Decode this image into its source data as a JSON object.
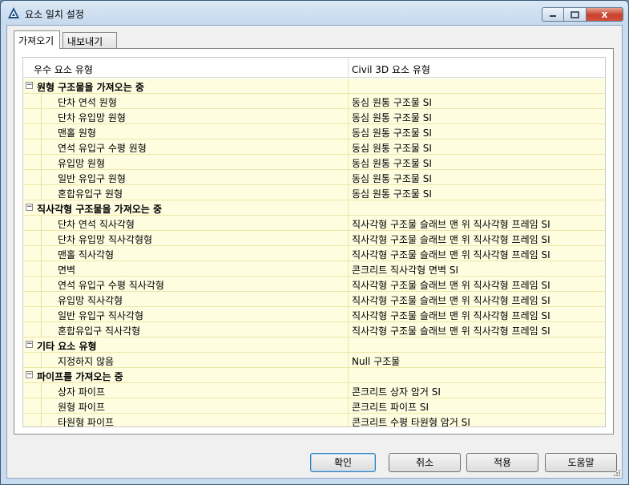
{
  "window": {
    "title": "요소 일치 설정",
    "close_label": "x"
  },
  "tabs": [
    {
      "label": "가져오기",
      "active": true
    },
    {
      "label": "내보내기",
      "active": false
    }
  ],
  "grid": {
    "columns": [
      "우수 요소 유형",
      "Civil 3D 요소 유형"
    ],
    "groups": [
      {
        "label": "원형 구조물을 가져오는 중",
        "items": [
          {
            "name": "단차 연석 원형",
            "value": "동심 원통 구조물 SI"
          },
          {
            "name": "단차 유입망 원형",
            "value": "동심 원통 구조물 SI"
          },
          {
            "name": "맨홀 원형",
            "value": "동심 원통 구조물 SI"
          },
          {
            "name": "연석 유입구 수평 원형",
            "value": "동심 원통 구조물 SI"
          },
          {
            "name": "유입망 원형",
            "value": "동심 원통 구조물 SI"
          },
          {
            "name": "일반 유입구 원형",
            "value": "동심 원통 구조물 SI"
          },
          {
            "name": "혼합유입구 원형",
            "value": "동심 원통 구조물 SI"
          }
        ]
      },
      {
        "label": "직사각형 구조물을 가져오는 중",
        "items": [
          {
            "name": "단차 연석 직사각형",
            "value": "직사각형 구조물 슬래브 맨 위 직사각형 프레임 SI"
          },
          {
            "name": "단차 유입망 직사각형형",
            "value": "직사각형 구조물 슬래브 맨 위 직사각형 프레임 SI"
          },
          {
            "name": "맨홀 직사각형",
            "value": "직사각형 구조물 슬래브 맨 위 직사각형 프레임 SI"
          },
          {
            "name": "면벽",
            "value": "콘크리트 직사각형 면벽 SI"
          },
          {
            "name": "연석 유입구 수평 직사각형",
            "value": "직사각형 구조물 슬래브 맨 위 직사각형 프레임 SI"
          },
          {
            "name": "유입망 직사각형",
            "value": "직사각형 구조물 슬래브 맨 위 직사각형 프레임 SI"
          },
          {
            "name": "일반 유입구 직사각형",
            "value": "직사각형 구조물 슬래브 맨 위 직사각형 프레임 SI"
          },
          {
            "name": "혼합유입구 직사각형",
            "value": "직사각형 구조물 슬래브 맨 위 직사각형 프레임 SI"
          }
        ]
      },
      {
        "label": "기타 요소 유형",
        "items": [
          {
            "name": "지정하지 않음",
            "value": "Null 구조물"
          }
        ]
      },
      {
        "label": "파이프를 가져오는 중",
        "items": [
          {
            "name": "상자 파이프",
            "value": "콘크리트 상자 암거 SI"
          },
          {
            "name": "원형 파이프",
            "value": "콘크리트 파이프 SI"
          },
          {
            "name": "타원형 파이프",
            "value": "콘크리트 수평 타원형 암거 SI"
          }
        ]
      }
    ]
  },
  "buttons": {
    "ok": "확인",
    "cancel": "취소",
    "apply": "적용",
    "help": "도움말"
  },
  "colors": {
    "row_bg": "#fefde0",
    "titlebar": "#c5d9ee",
    "close": "#c8402a"
  }
}
